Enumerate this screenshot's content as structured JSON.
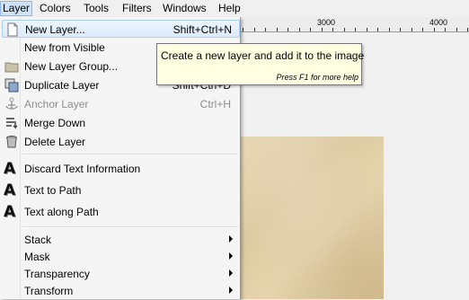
{
  "menubar": {
    "items": [
      {
        "label": "Layer",
        "active": true
      },
      {
        "label": "Colors"
      },
      {
        "label": "Tools"
      },
      {
        "label": "Filters"
      },
      {
        "label": "Windows"
      },
      {
        "label": "Help"
      }
    ]
  },
  "ruler": {
    "labels": [
      "3000",
      "4000"
    ]
  },
  "layer_menu": {
    "items": [
      {
        "label": "New Layer...",
        "shortcut": "Shift+Ctrl+N",
        "icon": "new-layer-icon",
        "highlighted": true
      },
      {
        "label": "New from Visible"
      },
      {
        "label": "New Layer Group...",
        "icon": "folder-icon"
      },
      {
        "label": "Duplicate Layer",
        "shortcut": "Shift+Ctrl+D",
        "icon": "duplicate-icon"
      },
      {
        "label": "Anchor Layer",
        "shortcut": "Ctrl+H",
        "icon": "anchor-icon",
        "disabled": true
      },
      {
        "label": "Merge Down",
        "icon": "merge-down-icon"
      },
      {
        "label": "Delete Layer",
        "icon": "delete-icon"
      },
      {
        "label": "Discard Text Information",
        "icon": "text-icon"
      },
      {
        "label": "Text to Path",
        "icon": "text-icon"
      },
      {
        "label": "Text along Path",
        "icon": "text-icon"
      },
      {
        "label": "Stack",
        "submenu": true
      },
      {
        "label": "Mask",
        "submenu": true
      },
      {
        "label": "Transparency",
        "submenu": true
      },
      {
        "label": "Transform",
        "submenu": true
      }
    ]
  },
  "tooltip": {
    "text": "Create a new layer and add it to the image",
    "hint": "Press F1 for more help"
  },
  "colors": {
    "menu_bg": "#f5f5f5",
    "highlight_border": "#a8d0f7",
    "tooltip_bg": "#ffffe1",
    "disabled_text": "#8d8d8d"
  }
}
